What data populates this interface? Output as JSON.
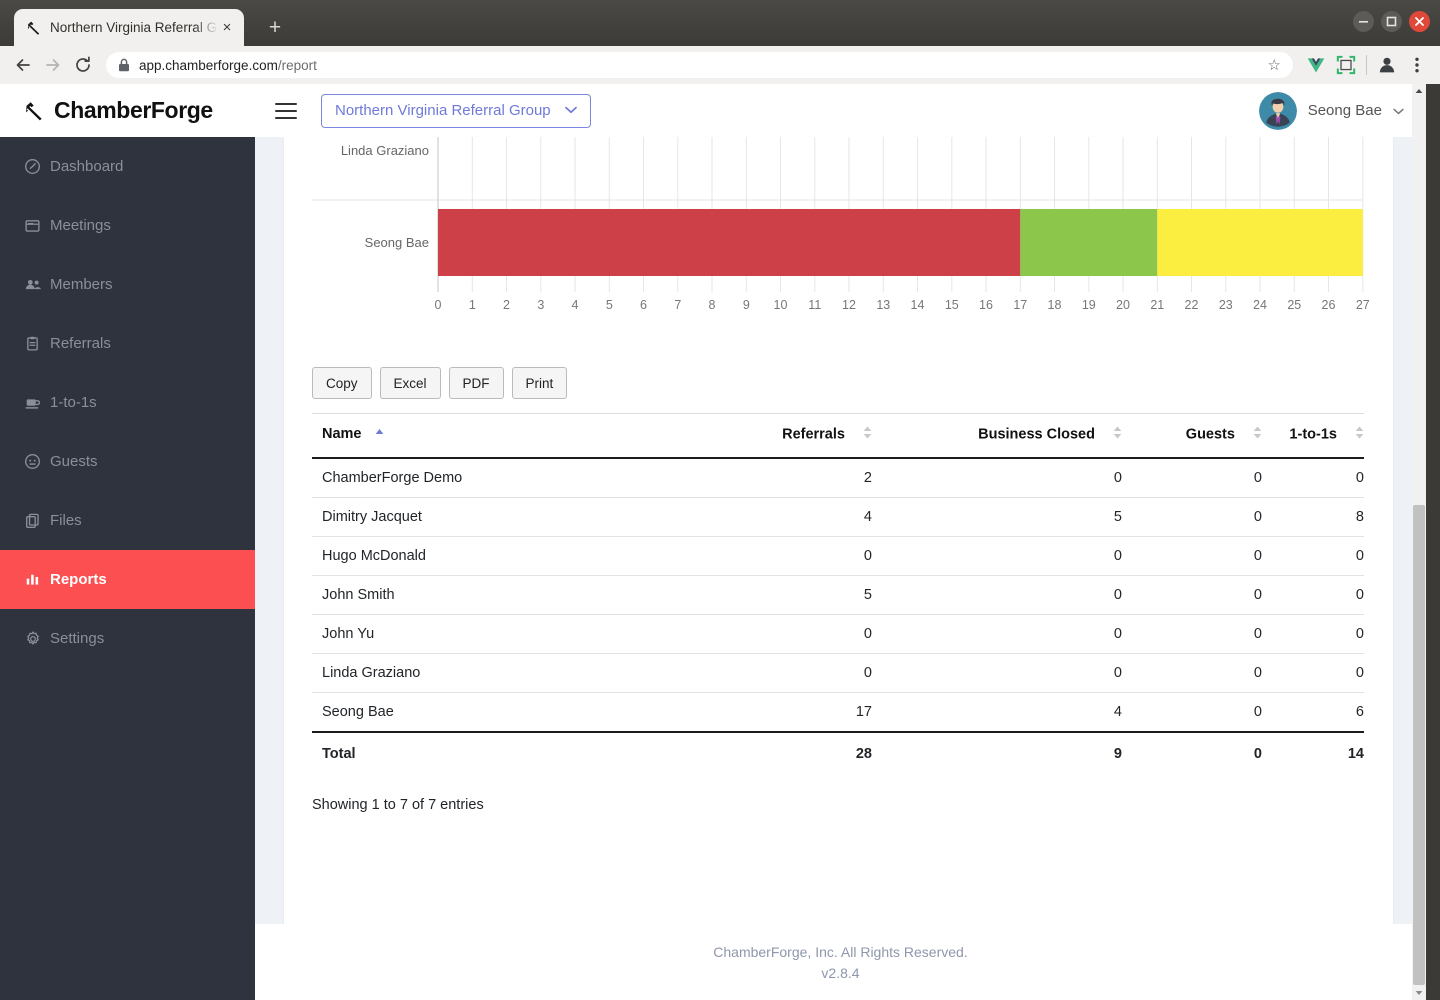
{
  "browser": {
    "tab_title": "Northern Virginia Referral Group",
    "tab_close_label": "×",
    "new_tab_label": "+",
    "url_host": "app.chamberforge.com",
    "url_path": "/report",
    "window_minimize": "–",
    "window_maximize": "□",
    "window_close": "×",
    "star_label": "☆"
  },
  "sidebar": {
    "brand": "ChamberForge",
    "items": [
      {
        "label": "Dashboard",
        "icon": "dashboard-icon",
        "active": false
      },
      {
        "label": "Meetings",
        "icon": "calendar-icon",
        "active": false
      },
      {
        "label": "Members",
        "icon": "people-icon",
        "active": false
      },
      {
        "label": "Referrals",
        "icon": "clipboard-icon",
        "active": false
      },
      {
        "label": "1-to-1s",
        "icon": "coffee-icon",
        "active": false
      },
      {
        "label": "Guests",
        "icon": "face-icon",
        "active": false
      },
      {
        "label": "Files",
        "icon": "copy-icon",
        "active": false
      },
      {
        "label": "Reports",
        "icon": "bar-chart-icon",
        "active": true
      },
      {
        "label": "Settings",
        "icon": "gear-icon",
        "active": false
      }
    ]
  },
  "topnav": {
    "group_selector": "Northern Virginia Referral Group",
    "group_selector_chevron": "⌄",
    "user_name": "Seong Bae",
    "user_chevron": "⌄"
  },
  "toolbar": {
    "copy_label": "Copy",
    "excel_label": "Excel",
    "pdf_label": "PDF",
    "print_label": "Print"
  },
  "table": {
    "headers": [
      "Name",
      "Referrals",
      "Business Closed",
      "Guests",
      "1-to-1s"
    ],
    "sorted_column": "Name",
    "sort_direction": "asc",
    "rows": [
      {
        "name": "ChamberForge Demo",
        "referrals": "2",
        "business_closed": "0",
        "guests": "0",
        "one_to_ones": "0"
      },
      {
        "name": "Dimitry Jacquet",
        "referrals": "4",
        "business_closed": "5",
        "guests": "0",
        "one_to_ones": "8"
      },
      {
        "name": "Hugo McDonald",
        "referrals": "0",
        "business_closed": "0",
        "guests": "0",
        "one_to_ones": "0"
      },
      {
        "name": "John Smith",
        "referrals": "5",
        "business_closed": "0",
        "guests": "0",
        "one_to_ones": "0"
      },
      {
        "name": "John Yu",
        "referrals": "0",
        "business_closed": "0",
        "guests": "0",
        "one_to_ones": "0"
      },
      {
        "name": "Linda Graziano",
        "referrals": "0",
        "business_closed": "0",
        "guests": "0",
        "one_to_ones": "0"
      },
      {
        "name": "Seong Bae",
        "referrals": "17",
        "business_closed": "4",
        "guests": "0",
        "one_to_ones": "6"
      }
    ],
    "total": {
      "name": "Total",
      "referrals": "28",
      "business_closed": "9",
      "guests": "0",
      "one_to_ones": "14"
    },
    "info": "Showing 1 to 7 of 7 entries"
  },
  "footer": {
    "copyright": "ChamberForge, Inc. All Rights Reserved.",
    "version": "v2.8.4"
  },
  "chart_data": {
    "type": "bar",
    "orientation": "horizontal",
    "stacked": true,
    "title": "",
    "xlabel": "",
    "ylabel": "",
    "categories": [
      "Linda Graziano",
      "Seong Bae"
    ],
    "series": [
      {
        "name": "Referrals",
        "color": "#cd4048",
        "values": [
          0,
          17
        ]
      },
      {
        "name": "Business Closed",
        "color": "#8cc64a",
        "values": [
          0,
          4
        ]
      },
      {
        "name": "1-to-1s",
        "color": "#fbee40",
        "values": [
          0,
          6
        ]
      }
    ],
    "xticks": [
      0,
      1,
      2,
      3,
      4,
      5,
      6,
      7,
      8,
      9,
      10,
      11,
      12,
      13,
      14,
      15,
      16,
      17,
      18,
      19,
      20,
      21,
      22,
      23,
      24,
      25,
      26,
      27
    ],
    "xlim": [
      0,
      27
    ],
    "grid": true,
    "legend_position": "none",
    "note": "view is scrolled; only the last two category rows are visible"
  }
}
